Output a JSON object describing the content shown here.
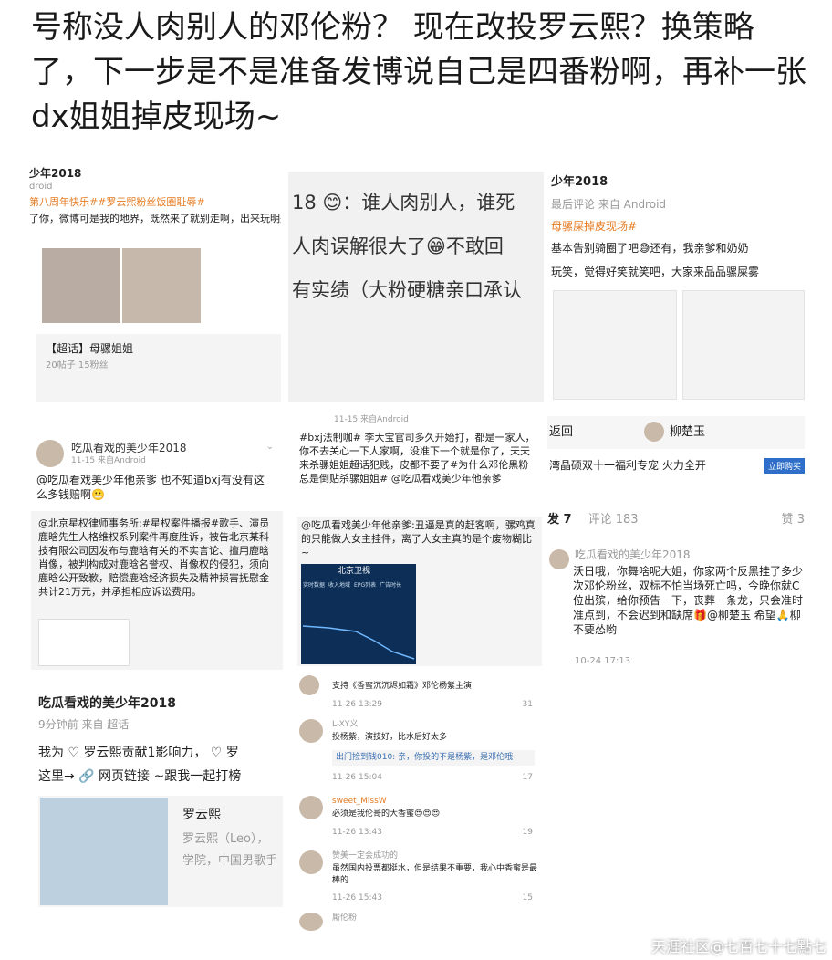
{
  "headline": "号称没人肉别人的邓伦粉？ 现在改投罗云熙？换策略了，下一步是不是准备发博说自己是四番粉啊，再补一张dx姐姐掉皮现场~",
  "shot1": {
    "year": "少年2018",
    "meta": "droid",
    "tag": "第八周年快乐##罗云熙粉丝饭圈耻辱#",
    "text": "了你，微博可是我的地界，既然来了就别走啊，出来玩明别",
    "supertopic": "【超话】母骡姐姐",
    "stats": "20帖子 15粉丝"
  },
  "shot2": {
    "line1": "18 😊：谁人肉别人，谁死",
    "line2": "人肉误解很大了😁不敢回",
    "line3": "有实绩（大粉硬糖亲口承认"
  },
  "shot3": {
    "year": "少年2018",
    "meta": "最后评论 来自 Android",
    "tag": "母骡屎掉皮现场#",
    "line1": "基本告别骑圈了吧😅还有，我亲爹和奶奶",
    "line2": "玩笑，觉得好笑就笑吧，大家来品品骡屎雾"
  },
  "shot4": {
    "name": "吃瓜看戏的美少年2018",
    "meta": "11-15 来自Android",
    "reply": "@吃瓜看戏美少年他亲爹 也不知道bxj有没有这么多钱赔啊😬",
    "quote": "@北京星权律师事务所:#星权案件播报#歌手、演员鹿晗先生人格维权系列案件再度胜诉，被告北京某科技有限公司因发布与鹿晗有关的不实言论、擅用鹿晗肖像，被判构成对鹿晗名誉权、肖像权的侵犯，须向鹿晗公开致歉，赔偿鹿晗经济损失及精神损害抚慰金共计21万元，并承担相应诉讼费用。"
  },
  "shot5": {
    "meta": "11-15 来自Android",
    "post": "#bxj法制咖# 李大宝官司多久开始打，都是一家人，你不去关心一下人家啊，没准下一个就是你了，天天来杀骡姐姐超话犯贱，皮都不要了#为什么邓伦黑粉总是倒贴杀骡姐姐# @吃瓜看戏美少年他亲爹",
    "quote": "@吃瓜看戏美少年他亲爹:丑逼是真的赶客啊，骡鸡真的只能做大女主挂件，离了大女主真的是个废物糊比~",
    "tv_title": "北京卫视",
    "tabs": [
      "实时数据",
      "收入地域",
      "EPG列表",
      "广告时长"
    ]
  },
  "shot6": {
    "back": "返回",
    "user": "柳楚玉",
    "ad": "湾晶硕双十一福利专宠 火力全开",
    "ad_btn": "立即购买",
    "tab_a": "发 7",
    "tab_b": "评论 183",
    "tab_c": "赞 3",
    "name": "吃瓜看戏的美少年2018",
    "text": "沃日哦，你舞啥呢大姐，你家两个反黑挂了多少次邓伦粉丝，双标不怕当场死亡吗，今晚你就C位出殡，给你预告一下，丧葬一条龙，只会准时准点到，不会迟到和缺席🎁@柳楚玉 希望🙏柳不要怂哟",
    "time": "10-24 17:13"
  },
  "shot7": {
    "name": "吃瓜看戏的美少年2018",
    "meta": "9分钟前 来自 超话",
    "line1": "我为 ♡ 罗云熙贡献1影响力， ♡ 罗",
    "line2": "这里→ 🔗 网页链接 ~跟我一起打榜",
    "star_name": "罗云熙",
    "star_desc1": "罗云熙（Leo），",
    "star_desc2": "学院，中国男歌手"
  },
  "shot8": {
    "comments": [
      {
        "user": "",
        "text": "支持《香蜜沉沉烬如霜》邓伦杨紫主演",
        "time": "11-26 13:29",
        "likes": "31"
      },
      {
        "user": "L-XY义",
        "text": "投杨紫，演技好，比水后好太多",
        "reply": "出门捡到钱010: 亲，你投的不是杨紫，是邓伦哦",
        "time": "11-26 15:04",
        "likes": "17"
      },
      {
        "user": "sweet_MissW",
        "text": "必须是我伦哥的大香蜜😍😍😍",
        "time": "11-26 13:43",
        "likes": "19"
      },
      {
        "user": "赞美一定会成功的",
        "text": "虽然国内投票都挺水，但是结果不重要，我心中香蜜是最棒的",
        "time": "11-26 15:43",
        "likes": "15"
      },
      {
        "user": "厮伦粉",
        "text": "",
        "time": "",
        "likes": ""
      }
    ]
  },
  "footer": "天涯社区@七百七十七點七",
  "colors": {
    "accent": "#e57b22",
    "link": "#3a6fb0",
    "muted": "#999999"
  }
}
